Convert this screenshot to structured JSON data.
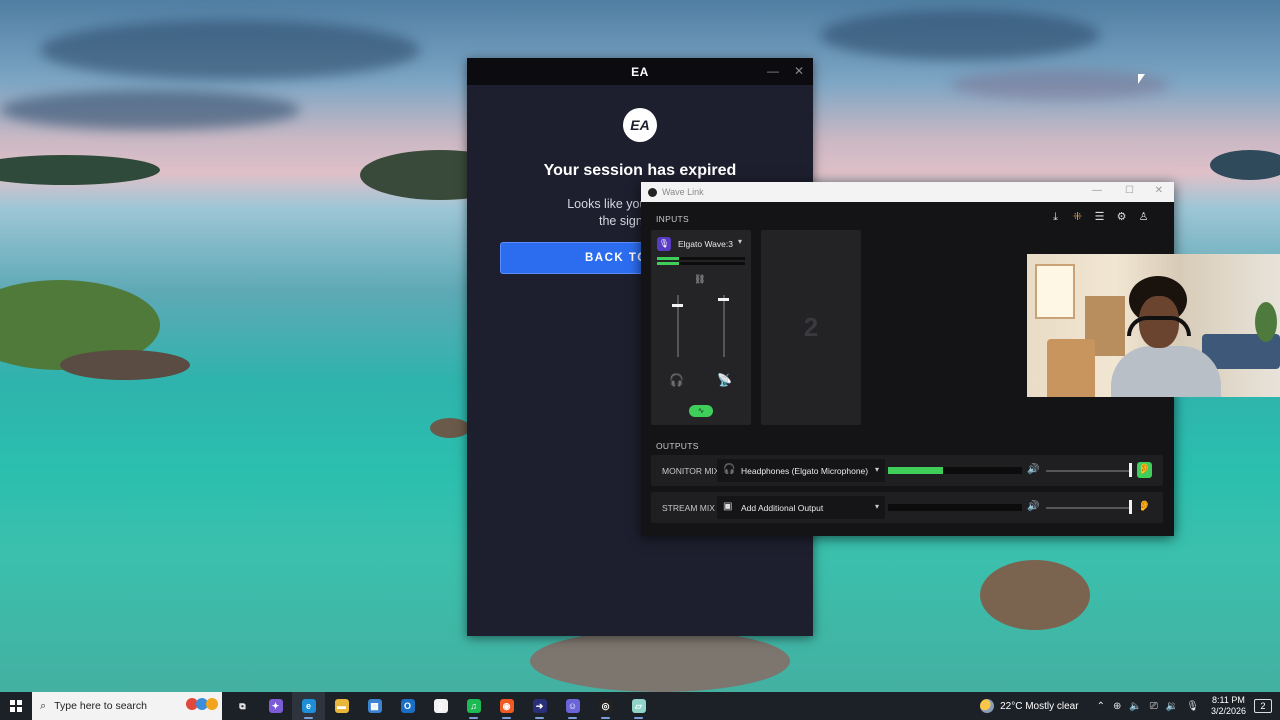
{
  "ea_window": {
    "title": "EA",
    "logo_text": "EA",
    "heading": "Your session has expired",
    "body_line1": "Looks like you've been aw",
    "body_line2": "the sign-in pag",
    "button_label": "BACK TO",
    "brand_color": "#2c6df0"
  },
  "wave_link": {
    "title": "Wave Link",
    "inputs_label": "INPUTS",
    "outputs_label": "OUTPUTS",
    "toolbar_icons": [
      "download-icon",
      "apps-grid-icon",
      "mixer-settings-icon",
      "gear-icon",
      "profile-icon"
    ],
    "channel": {
      "name": "Elgato Wave:3",
      "meter_level": 0.25,
      "monitor_level": 0.85,
      "stream_level": 0.95
    },
    "empty_slot_number": "2",
    "outputs": [
      {
        "label": "MONITOR MIX",
        "device": "Headphones (Elgato Microphone)",
        "meter_level": 0.41,
        "volume": 1.0,
        "listening": true
      },
      {
        "label": "STREAM MIX",
        "device": "Add Additional Output",
        "meter_level": 0.0,
        "volume": 1.0,
        "listening": false
      }
    ],
    "accent_color": "#3fce5a"
  },
  "taskbar": {
    "search_placeholder": "Type here to search",
    "apps": [
      {
        "name": "task-view-icon",
        "glyph": "⧉",
        "color": "transparent",
        "open": false,
        "active": false
      },
      {
        "name": "copilot-icon",
        "glyph": "✦",
        "color": "#7b5cd6",
        "open": false,
        "active": false
      },
      {
        "name": "edge-icon",
        "glyph": "e",
        "color": "#1f8ed8",
        "open": true,
        "active": true
      },
      {
        "name": "file-explorer-icon",
        "glyph": "▬",
        "color": "#e8b63a",
        "open": false,
        "active": false
      },
      {
        "name": "store-icon",
        "glyph": "▦",
        "color": "#3b82d0",
        "open": false,
        "active": false
      },
      {
        "name": "outlook-icon",
        "glyph": "O",
        "color": "#1a6fc4",
        "open": false,
        "active": false
      },
      {
        "name": "document-icon",
        "glyph": "▯",
        "color": "#f2f2f2",
        "open": false,
        "active": false
      },
      {
        "name": "spotify-icon",
        "glyph": "♫",
        "color": "#1db954",
        "open": true,
        "active": false
      },
      {
        "name": "origin-icon",
        "glyph": "◉",
        "color": "#f05a22",
        "open": true,
        "active": false
      },
      {
        "name": "ea-app-icon",
        "glyph": "➜",
        "color": "#2a2f7a",
        "open": true,
        "active": false
      },
      {
        "name": "discord-icon",
        "glyph": "☺",
        "color": "#6b63d8",
        "open": true,
        "active": false
      },
      {
        "name": "wave-link-icon",
        "glyph": "◎",
        "color": "#222222",
        "open": true,
        "active": false
      },
      {
        "name": "app-icon",
        "glyph": "▱",
        "color": "#8fd3c9",
        "open": true,
        "active": false
      }
    ],
    "weather": "22°C  Mostly clear",
    "time": "8:11 PM",
    "date": "3/2/2026",
    "notification_count": "2"
  }
}
